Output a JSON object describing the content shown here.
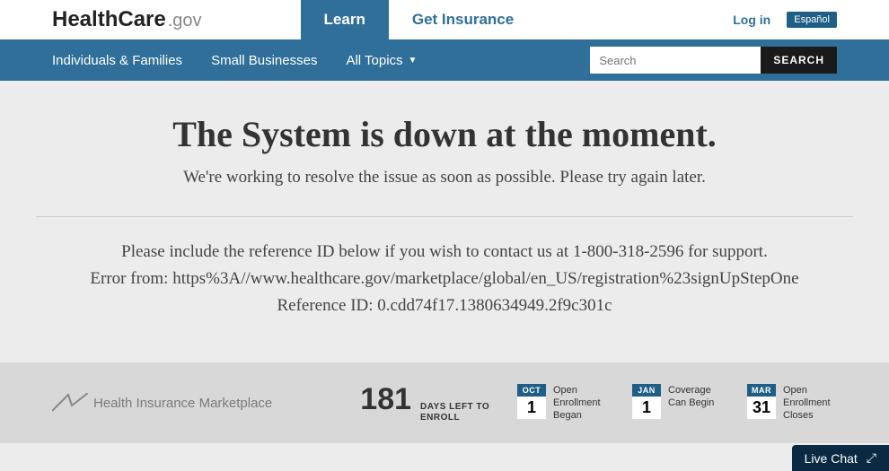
{
  "logo": {
    "health": "Health",
    "care": "Care",
    "gov": ".gov"
  },
  "tabs": {
    "learn": "Learn",
    "get_insurance": "Get Insurance"
  },
  "top_right": {
    "login": "Log in",
    "espanol": "Español"
  },
  "nav": {
    "individuals": "Individuals & Families",
    "small_biz": "Small Businesses",
    "all_topics": "All Topics"
  },
  "search": {
    "placeholder": "Search",
    "button": "SEARCH"
  },
  "error": {
    "headline": "The System is down at the moment.",
    "subline": "We're working to resolve the issue as soon as possible. Please try again later.",
    "support_line": "Please include the reference ID below if you wish to contact us at 1-800-318-2596 for support.",
    "error_from": "Error from: https%3A//www.healthcare.gov/marketplace/global/en_US/registration%23signUpStepOne",
    "reference_id": "Reference ID: 0.cdd74f17.1380634949.2f9c301c"
  },
  "footer": {
    "marketplace": "Health Insurance Marketplace",
    "counter_num": "181",
    "counter_label_1": "DAYS LEFT TO",
    "counter_label_2": "ENROLL",
    "dates": [
      {
        "mon": "OCT",
        "day": "1",
        "label": "Open Enrollment Began"
      },
      {
        "mon": "JAN",
        "day": "1",
        "label": "Coverage Can Begin"
      },
      {
        "mon": "MAR",
        "day": "31",
        "label": "Open Enrollment Closes"
      }
    ]
  },
  "chat": {
    "label": "Live Chat"
  }
}
